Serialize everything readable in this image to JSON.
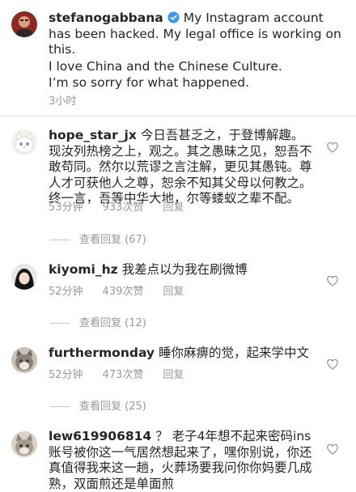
{
  "caption": {
    "username": "stefanogabbana",
    "text": "My Instagram account has been hacked. My legal office is working on this.",
    "line2": "I love China and the Chinese Culture.",
    "line3": "I’m so sorry for what happened.",
    "time": "3小时"
  },
  "comments": [
    {
      "username": "hope_star_jx",
      "text": "今日吾甚乏之，于登博解趣。现汝列热榜之上，观之。其之愚昧之见，恕吾不敢苟同。然尔以荒谬之言注解，更见其愚钝。尊人才可获他人之尊，恕余不知其父母以何教之。终一言，吾等中华大地，尔等蝼蚁之辈不配。",
      "time": "53分钟",
      "likes": "933次赞",
      "reply": "回复",
      "view_replies": "查看回复 (67)"
    },
    {
      "username": "kiyomi_hz",
      "text": "我差点以为我在刷微博",
      "time": "52分钟",
      "likes": "439次赞",
      "reply": "回复",
      "view_replies": "查看回复 (12)"
    },
    {
      "username": "furthermonday",
      "text": "睡你麻痹的觉，起来学中文",
      "time": "52分钟",
      "likes": "473次赞",
      "reply": "回复",
      "view_replies": "查看回复 (25)"
    },
    {
      "username": "lew619906814",
      "text": "？ 老子4年想不起来密码ins账号被你这一气居然想起来了，嘿你别说，你还真值得我来这一趟，火葬场要我问你你妈要几成熟，双面煎还是单面煎"
    }
  ],
  "icons": {
    "verified": "verified-badge-icon",
    "heart": "heart-outline-icon"
  },
  "colors": {
    "text": "#262626",
    "meta": "#999999",
    "verified_blue": "#3897f0"
  }
}
